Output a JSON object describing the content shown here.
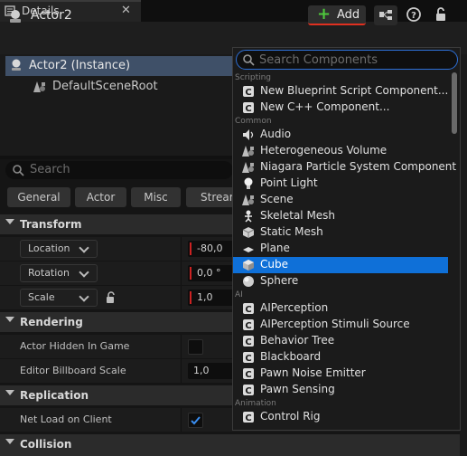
{
  "tab": {
    "title": "Details",
    "close_glyph": "✕"
  },
  "header": {
    "actor_name": "Actor2",
    "add_label": "Add",
    "add_glyph": "+",
    "help_glyph": "?"
  },
  "tree": {
    "instance_label": "Actor2 (Instance)",
    "root_label": "DefaultSceneRoot"
  },
  "details_search": {
    "placeholder": "Search"
  },
  "categories": [
    "General",
    "Actor",
    "Misc",
    "Streaming"
  ],
  "sections": {
    "transform": "Transform",
    "rendering": "Rendering",
    "replication": "Replication",
    "collision": "Collision"
  },
  "transform": {
    "location_label": "Location",
    "location_value": "-80,0",
    "rotation_label": "Rotation",
    "rotation_value": "0,0 °",
    "scale_label": "Scale",
    "scale_value": "1,0"
  },
  "rendering": {
    "hidden_label": "Actor Hidden In Game",
    "billboard_label": "Editor Billboard Scale",
    "billboard_value": "1,0"
  },
  "replication": {
    "net_load_label": "Net Load on Client"
  },
  "popup": {
    "search_placeholder": "Search Components",
    "groups": [
      {
        "category": "Scripting",
        "items": [
          {
            "label": "New Blueprint Script Component...",
            "icon": "script-icon"
          },
          {
            "label": "New C++ Component...",
            "icon": "cpp-icon"
          }
        ]
      },
      {
        "category": "Common",
        "items": [
          {
            "label": "Audio",
            "icon": "speaker-icon"
          },
          {
            "label": "Heterogeneous Volume",
            "icon": "scene-icon"
          },
          {
            "label": "Niagara Particle System Component",
            "icon": "scene-icon"
          },
          {
            "label": "Point Light",
            "icon": "light-bulb-icon"
          },
          {
            "label": "Scene",
            "icon": "scene-icon"
          },
          {
            "label": "Skeletal Mesh",
            "icon": "skeleton-icon"
          },
          {
            "label": "Static Mesh",
            "icon": "mesh-icon"
          },
          {
            "label": "Plane",
            "icon": "plane-icon"
          },
          {
            "label": "Cube",
            "icon": "cube-icon"
          },
          {
            "label": "Sphere",
            "icon": "sphere-icon"
          }
        ]
      },
      {
        "category": "AI",
        "items": [
          {
            "label": "AIPerception",
            "icon": "component-icon"
          },
          {
            "label": "AIPerception Stimuli Source",
            "icon": "component-icon"
          },
          {
            "label": "Behavior Tree",
            "icon": "component-icon"
          },
          {
            "label": "Blackboard",
            "icon": "component-icon"
          },
          {
            "label": "Pawn Noise Emitter",
            "icon": "component-icon"
          },
          {
            "label": "Pawn Sensing",
            "icon": "component-icon"
          }
        ]
      },
      {
        "category": "Animation",
        "items": [
          {
            "label": "Control Rig",
            "icon": "component-icon"
          }
        ]
      }
    ],
    "selected": "Cube"
  },
  "colors": {
    "accent": "#0f70d8",
    "add_underline": "#e03020",
    "plus": "#4ec83c"
  }
}
